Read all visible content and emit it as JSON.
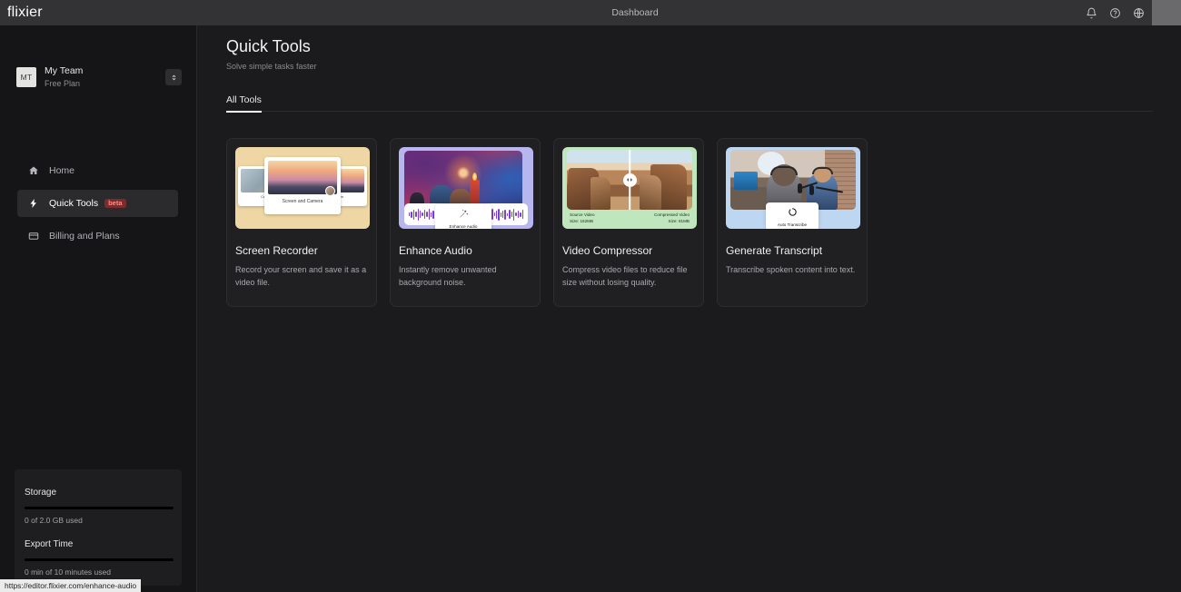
{
  "topbar": {
    "logo": "flixier",
    "title": "Dashboard",
    "icons": [
      {
        "name": "bell-icon",
        "label": "Notifications"
      },
      {
        "name": "help-icon",
        "label": "Help"
      },
      {
        "name": "globe-icon",
        "label": "Language"
      }
    ]
  },
  "sidebar": {
    "team": {
      "initials": "MT",
      "name": "My Team",
      "plan": "Free Plan"
    },
    "nav": [
      {
        "label": "Home",
        "icon": "home-icon",
        "active": false,
        "badge": ""
      },
      {
        "label": "Quick Tools",
        "icon": "bolt-icon",
        "active": true,
        "badge": "beta"
      },
      {
        "label": "Billing and Plans",
        "icon": "credit-card-icon",
        "active": false,
        "badge": ""
      }
    ],
    "usage": {
      "storage_title": "Storage",
      "storage_value": "0 of 2.0 GB used",
      "storage_percent": 0,
      "export_title": "Export Time",
      "export_value": "0 min of 10 minutes used",
      "export_percent": 0
    }
  },
  "statusbar": {
    "url": "https://editor.flixier.com/enhance-audio"
  },
  "main": {
    "title": "Quick Tools",
    "subtitle": "Solve simple tasks faster",
    "tabs": [
      {
        "label": "All Tools",
        "active": true
      }
    ],
    "cards": [
      {
        "title": "Screen Recorder",
        "description": "Record your screen and save it as a video file.",
        "thumb": {
          "bg": "#eed7a4",
          "left_label": "Camera",
          "center_label": "Screen and Camera",
          "right_label": "Screen"
        }
      },
      {
        "title": "Enhance Audio",
        "description": "Instantly remove unwanted background noise.",
        "thumb": {
          "bg": "#b7b6ef",
          "button_label": "Enhance Audio",
          "button_icon": "magic-wand-icon"
        }
      },
      {
        "title": "Video Compressor",
        "description": "Compress video files to reduce file size without losing quality.",
        "thumb": {
          "bg": "#bfe6bd",
          "left_label": "Source Video",
          "left_size": "Size: 152MB",
          "right_label": "Compressed Video",
          "right_size": "Size: 81MB"
        }
      },
      {
        "title": "Generate Transcript",
        "description": "Transcribe spoken content into text.",
        "thumb": {
          "bg": "#bdd6f2",
          "button_label": "Auto Transcribe",
          "button_icon": "spinner-icon"
        }
      }
    ]
  }
}
